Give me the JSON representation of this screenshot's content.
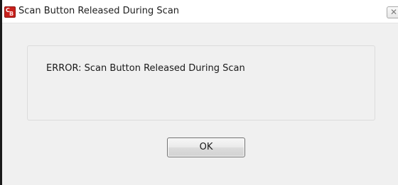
{
  "window": {
    "title": "Scan Button Released During Scan",
    "app_icon": "app-logo-icon",
    "close_icon": "close-icon",
    "close_glyph": "✕"
  },
  "dialog": {
    "message": "ERROR: Scan Button Released During Scan",
    "ok_label": "OK"
  },
  "colors": {
    "app_icon_red": "#c8201c",
    "dialog_background": "#f0f0f0"
  }
}
